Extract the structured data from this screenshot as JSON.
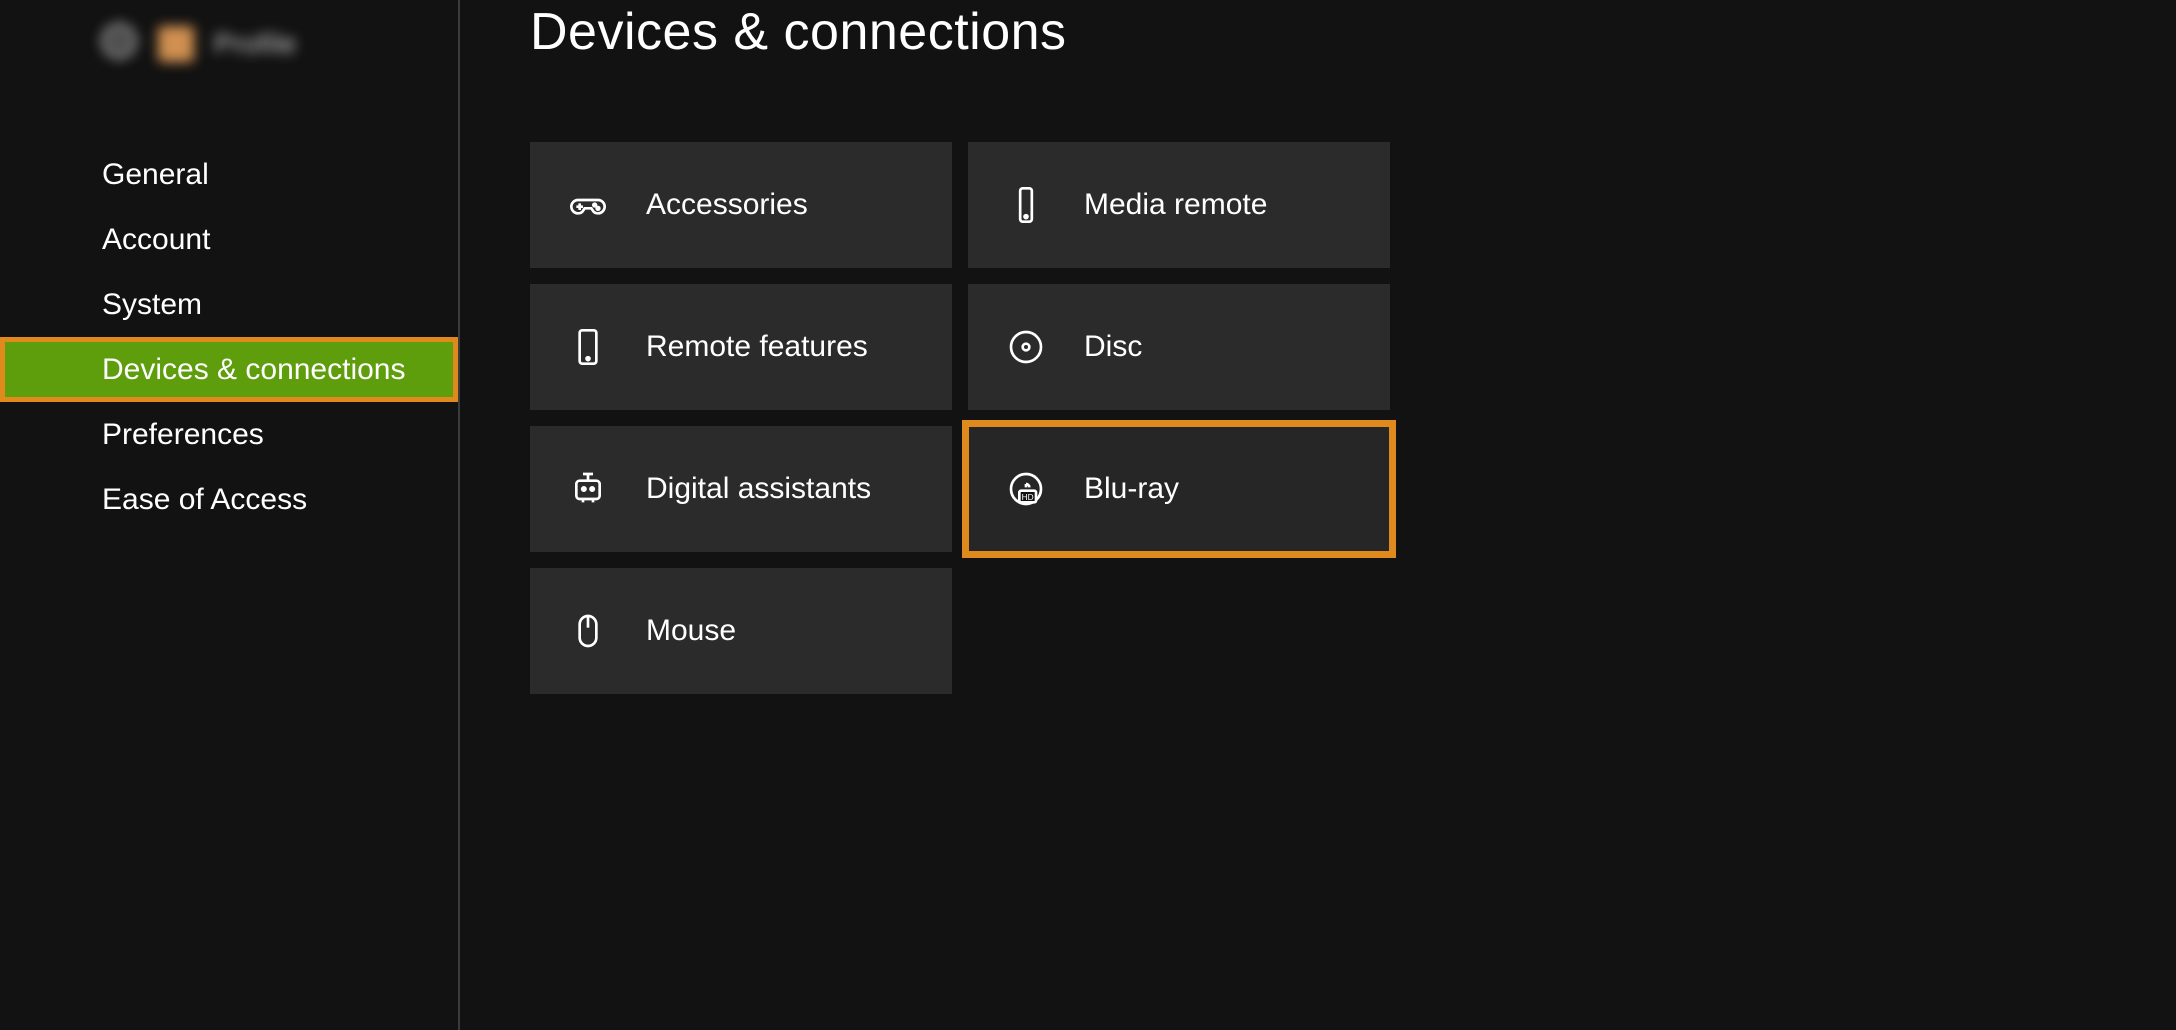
{
  "header": {
    "profile_name": "Profile"
  },
  "sidebar": {
    "items": [
      {
        "label": "General"
      },
      {
        "label": "Account"
      },
      {
        "label": "System"
      },
      {
        "label": "Devices & connections"
      },
      {
        "label": "Preferences"
      },
      {
        "label": "Ease of Access"
      }
    ],
    "selected_index": 3
  },
  "page": {
    "title": "Devices & connections"
  },
  "tiles": [
    {
      "label": "Accessories",
      "icon": "controller-icon"
    },
    {
      "label": "Media remote",
      "icon": "phone-icon"
    },
    {
      "label": "Remote features",
      "icon": "tablet-icon"
    },
    {
      "label": "Disc",
      "icon": "disc-icon"
    },
    {
      "label": "Digital assistants",
      "icon": "robot-icon"
    },
    {
      "label": "Blu-ray",
      "icon": "bluray-icon"
    },
    {
      "label": "Mouse",
      "icon": "mouse-icon"
    }
  ],
  "highlighted_tile_index": 5,
  "colors": {
    "selection_green": "#5e9d0b",
    "highlight_orange": "#e08a1e",
    "tile_bg": "#2b2b2b",
    "page_bg": "#121212"
  }
}
